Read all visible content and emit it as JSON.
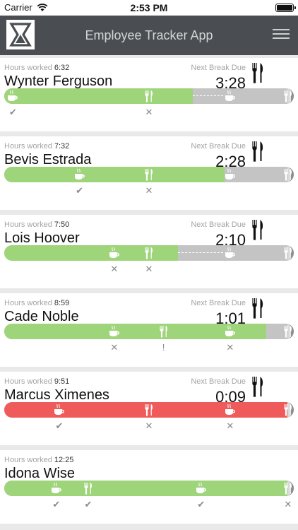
{
  "status_bar": {
    "carrier": "Carrier",
    "time": "2:53 PM"
  },
  "header": {
    "title": "Employee Tracker App",
    "logo_icon": "hourglass-logo-icon",
    "menu_icon": "hamburger-menu-icon"
  },
  "labels": {
    "hours_worked": "Hours worked",
    "next_break_due": "Next Break Due"
  },
  "colors": {
    "on_track": "#9ed47a",
    "overdue": "#ef5b5b",
    "remaining": "#c4c4c4",
    "header": "#4a4e53"
  },
  "employees": [
    {
      "name": "Wynter Ferguson",
      "hours_worked": "6:32",
      "next_break": "3:28",
      "state": "normal",
      "progress": 0.65,
      "markers": [
        {
          "icon": "coffee-icon",
          "at": 0.03,
          "status": "check"
        },
        {
          "icon": "cutlery-icon",
          "at": 0.5,
          "status": "cross"
        },
        {
          "icon": "coffee-icon",
          "at": 0.78,
          "status": ""
        },
        {
          "icon": "cutlery-icon",
          "at": 0.98,
          "status": ""
        }
      ]
    },
    {
      "name": "Bevis Estrada",
      "hours_worked": "7:32",
      "next_break": "2:28",
      "state": "normal",
      "progress": 0.76,
      "markers": [
        {
          "icon": "coffee-icon",
          "at": 0.26,
          "status": "check"
        },
        {
          "icon": "cutlery-icon",
          "at": 0.5,
          "status": "cross"
        },
        {
          "icon": "coffee-icon",
          "at": 0.78,
          "status": ""
        },
        {
          "icon": "cutlery-icon",
          "at": 0.98,
          "status": ""
        }
      ]
    },
    {
      "name": "Lois Hoover",
      "hours_worked": "7:50",
      "next_break": "2:10",
      "state": "normal",
      "progress": 0.6,
      "markers": [
        {
          "icon": "coffee-icon",
          "at": 0.38,
          "status": "cross"
        },
        {
          "icon": "cutlery-icon",
          "at": 0.5,
          "status": "cross"
        },
        {
          "icon": "coffee-icon",
          "at": 0.78,
          "status": ""
        },
        {
          "icon": "cutlery-icon",
          "at": 0.98,
          "status": ""
        }
      ]
    },
    {
      "name": "Cade Noble",
      "hours_worked": "8:59",
      "next_break": "1:01",
      "state": "normal",
      "progress": 0.905,
      "markers": [
        {
          "icon": "coffee-icon",
          "at": 0.38,
          "status": "cross"
        },
        {
          "icon": "cutlery-icon",
          "at": 0.55,
          "status": "warning"
        },
        {
          "icon": "coffee-icon",
          "at": 0.78,
          "status": "cross"
        },
        {
          "icon": "cutlery-icon",
          "at": 0.98,
          "status": ""
        }
      ]
    },
    {
      "name": "Marcus Ximenes",
      "hours_worked": "9:51",
      "next_break": "0:09",
      "state": "overdue",
      "progress": 0.985,
      "markers": [
        {
          "icon": "coffee-icon",
          "at": 0.19,
          "status": "check"
        },
        {
          "icon": "cutlery-icon",
          "at": 0.5,
          "status": "cross"
        },
        {
          "icon": "coffee-icon",
          "at": 0.78,
          "status": "cross"
        },
        {
          "icon": "cutlery-icon",
          "at": 0.98,
          "status": ""
        }
      ]
    },
    {
      "name": "Idona Wise",
      "hours_worked": "12:25",
      "next_break": "",
      "state": "normal",
      "progress": 1.0,
      "markers": [
        {
          "icon": "coffee-icon",
          "at": 0.18,
          "status": "check"
        },
        {
          "icon": "cutlery-icon",
          "at": 0.29,
          "status": "check"
        },
        {
          "icon": "coffee-icon",
          "at": 0.68,
          "status": "check"
        },
        {
          "icon": "cutlery-icon",
          "at": 0.98,
          "status": "cross"
        }
      ]
    }
  ]
}
